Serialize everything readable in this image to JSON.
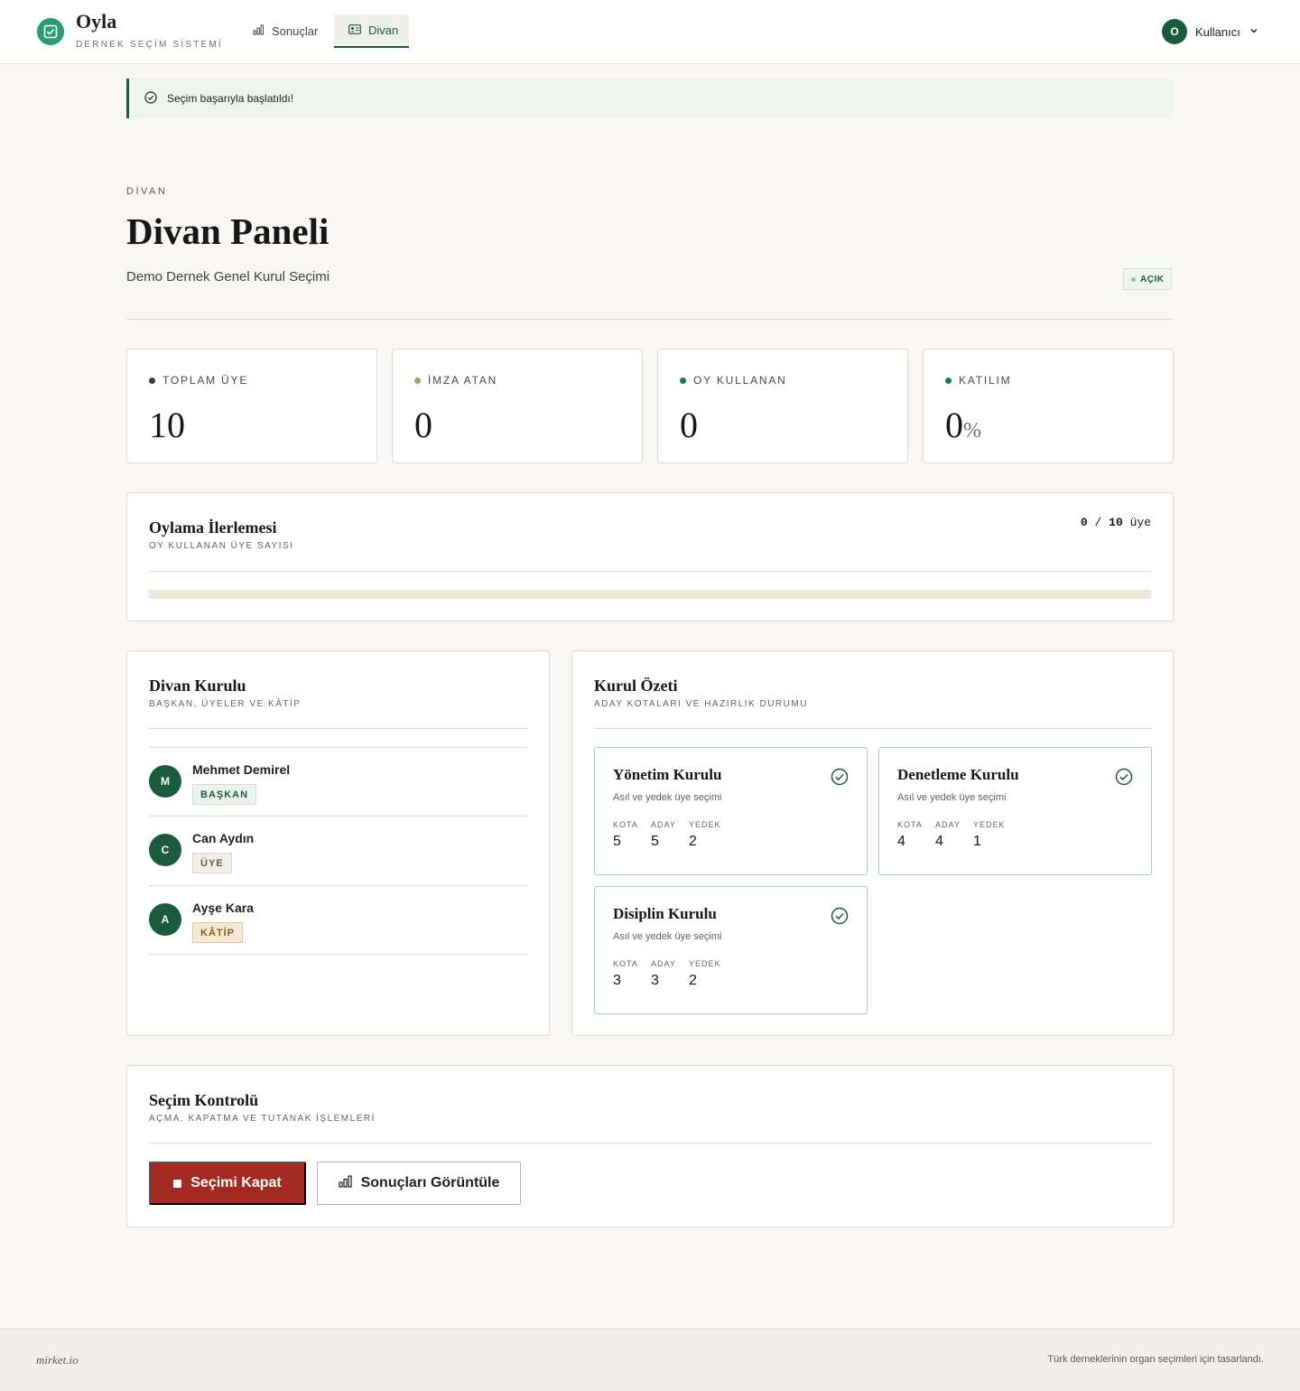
{
  "header": {
    "brand": "Oyla",
    "brand_sub": "DERNEK SEÇİM SİSTEMİ",
    "nav": [
      {
        "label": "Sonuçlar",
        "icon": "bar-chart-icon",
        "active": false
      },
      {
        "label": "Divan",
        "icon": "id-card-icon",
        "active": true
      }
    ],
    "user": {
      "initial": "O",
      "name": "Kullanıcı"
    }
  },
  "alert": {
    "text": "Seçim başarıyla başlatıldı!",
    "icon": "check-circle-icon"
  },
  "page": {
    "eyebrow": "DİVAN",
    "title": "Divan Paneli",
    "subtitle": "Demo Dernek Genel Kurul Seçimi",
    "status": "AÇIK"
  },
  "stats": [
    {
      "label": "TOPLAM ÜYE",
      "value": "10",
      "unit": "",
      "dot_color": "#3a3d40"
    },
    {
      "label": "İMZA ATAN",
      "value": "0",
      "unit": "",
      "dot_color": "#b59a6a"
    },
    {
      "label": "OY KULLANAN",
      "value": "0",
      "unit": "",
      "dot_color": "#1c7a4e"
    },
    {
      "label": "KATILIM",
      "value": "0",
      "unit": "%",
      "dot_color": "#1c7a4e"
    }
  ],
  "progress": {
    "title": "Oylama İlerlemesi",
    "subtitle": "OY KULLANAN ÜYE SAYISI",
    "voted": "0",
    "separator": "/",
    "total": "10",
    "unit": "üye",
    "fraction": 0
  },
  "divan": {
    "title": "Divan Kurulu",
    "subtitle": "BAŞKAN, ÜYELER VE KÂTİP",
    "members": [
      {
        "initial": "M",
        "name": "Mehmet Demirel",
        "role": "BAŞKAN"
      },
      {
        "initial": "C",
        "name": "Can Aydın",
        "role": "ÜYE"
      },
      {
        "initial": "A",
        "name": "Ayşe Kara",
        "role": "KÂTİP"
      }
    ]
  },
  "summary": {
    "title": "Kurul Özeti",
    "subtitle": "ADAY KOTALARI VE HAZIRLIK DURUMU",
    "labels": {
      "quota": "KOTA",
      "candidate": "ADAY",
      "reserve": "YEDEK"
    },
    "committees": [
      {
        "name": "Yönetim Kurulu",
        "desc": "Asıl ve yedek üye seçimi",
        "quota": "5",
        "candidate": "5",
        "reserve": "2"
      },
      {
        "name": "Denetleme Kurulu",
        "desc": "Asıl ve yedek üye seçimi",
        "quota": "4",
        "candidate": "4",
        "reserve": "1"
      },
      {
        "name": "Disiplin Kurulu",
        "desc": "Asıl ve yedek üye seçimi",
        "quota": "3",
        "candidate": "3",
        "reserve": "2"
      }
    ]
  },
  "control": {
    "title": "Seçim Kontrolü",
    "subtitle": "AÇMA, KAPATMA VE TUTANAK İŞLEMLERİ",
    "close_label": "Seçimi Kapat",
    "results_label": "Sonuçları Görüntüle"
  },
  "footer": {
    "left": "mirket.io",
    "right": "Türk derneklerinin organ seçimleri için tasarlandı."
  },
  "colors": {
    "accent": "#1c5a3e",
    "danger": "#a42a21",
    "brand": "#2a9d74"
  }
}
